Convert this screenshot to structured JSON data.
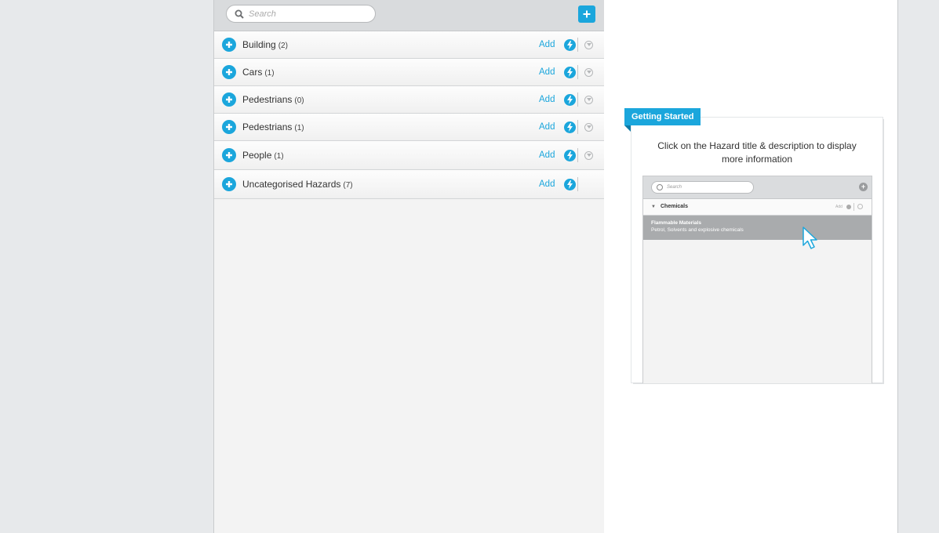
{
  "search": {
    "placeholder": "Search"
  },
  "toolbar": {
    "add_icon": "plus-icon",
    "accent": "#1ba6dc"
  },
  "categories": [
    {
      "title": "Building",
      "count": "(2)",
      "add_label": "Add"
    },
    {
      "title": "Cars",
      "count": "(1)",
      "add_label": "Add"
    },
    {
      "title": "Pedestrians",
      "count": "(0)",
      "add_label": "Add"
    },
    {
      "title": "Pedestrians",
      "count": "(1)",
      "add_label": "Add"
    },
    {
      "title": "People",
      "count": "(1)",
      "add_label": "Add"
    },
    {
      "title": "Uncategorised Hazards",
      "count": "(7)",
      "add_label": "Add"
    }
  ],
  "getting_started": {
    "tag": "Getting Started",
    "line1": "Click on the Hazard title & description to display",
    "line2": "more information",
    "preview": {
      "search_placeholder": "Search",
      "category": "Chemicals",
      "add_label": "Add",
      "item_title": "Flammable Materials",
      "item_desc": "Petrol, Solvents and explosive chemicals"
    }
  }
}
